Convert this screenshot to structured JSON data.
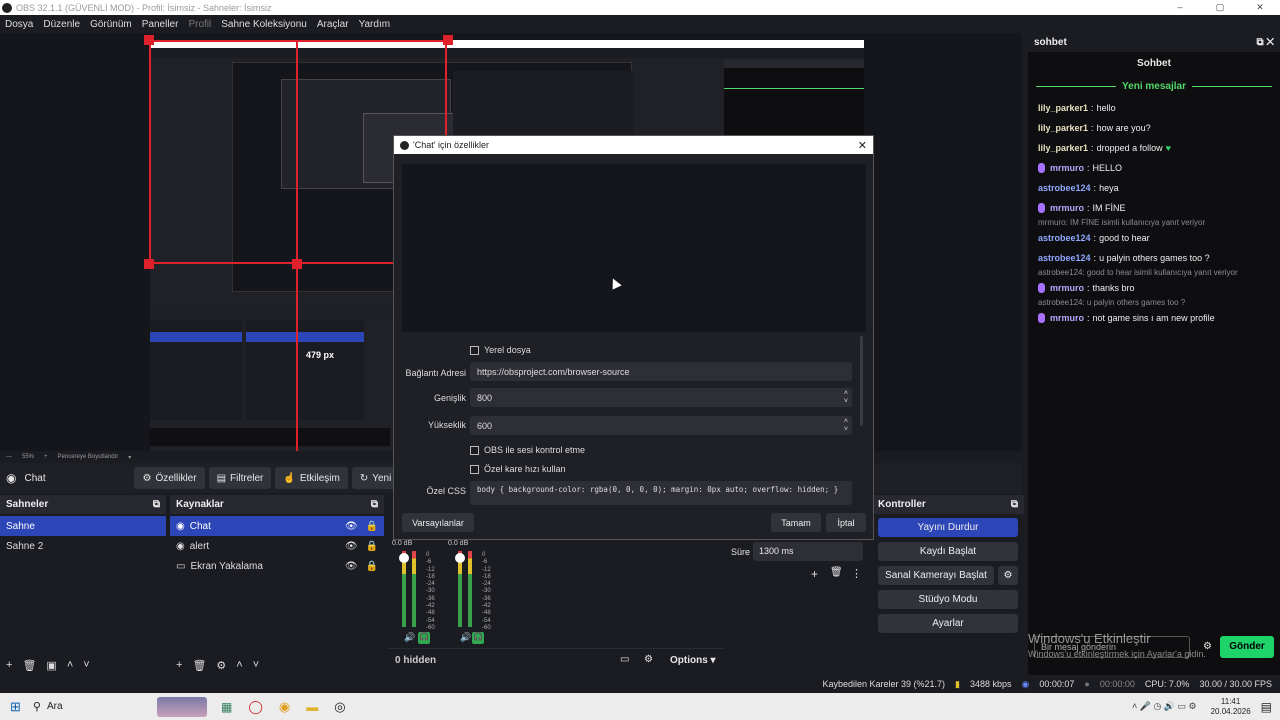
{
  "window": {
    "title": "OBS 32.1.1 (GÜVENLİ MOD) - Profil: İsimsiz - Sahneler: İsimsiz",
    "controls": [
      "–",
      "▢",
      "✕"
    ]
  },
  "menu": [
    "Dosya",
    "Düzenle",
    "Görünüm",
    "Paneller",
    "Profil",
    "Sahne Koleksiyonu",
    "Araçlar",
    "Yardım"
  ],
  "preview_zoom": {
    "zoom": "55%",
    "fit_label": "Pencereye Boyutlandır"
  },
  "source_toolbar": {
    "selected_source": "Chat",
    "properties": "Özellikler",
    "filters": "Filtreler",
    "interact": "Etkileşim",
    "refresh": "Yeni"
  },
  "scenes": {
    "title": "Sahneler",
    "items": [
      "Sahne",
      "Sahne 2"
    ],
    "selected_index": 0
  },
  "sources": {
    "title": "Kaynaklar",
    "items": [
      "Chat",
      "alert",
      "Ekran Yakalama"
    ],
    "selected_index": 0
  },
  "mixer": {
    "db_labels": [
      "0.0 dB",
      "0.0 dB"
    ],
    "scale": [
      "0",
      "-6",
      "-12",
      "-18",
      "-24",
      "-30",
      "-36",
      "-42",
      "-48",
      "-54",
      "-60"
    ],
    "hidden_label": "0 hidden",
    "options_label": "Options"
  },
  "transitions": {
    "duration_label": "Süre",
    "duration_value": "1300 ms"
  },
  "controls": {
    "title": "Kontroller",
    "stop_stream": "Yayını Durdur",
    "start_record": "Kaydı Başlat",
    "virtual_cam": "Sanal Kamerayı Başlat",
    "studio_mode": "Stüdyo Modu",
    "settings": "Ayarlar"
  },
  "dialog": {
    "title": "'Chat' için özellikler",
    "local_file": "Yerel dosya",
    "url_label": "Bağlantı Adresi",
    "url_value": "https://obsproject.com/browser-source",
    "width_label": "Genişlik",
    "width_value": "800",
    "height_label": "Yükseklik",
    "height_value": "600",
    "audio_control": "OBS ile sesi kontrol etme",
    "custom_fps": "Özel kare hızı kullan",
    "css_label": "Özel CSS",
    "css_value": "body { background-color: rgba(0, 0, 0, 0); margin: 0px auto; overflow: hidden; }",
    "defaults_btn": "Varsayılanlar",
    "ok_btn": "Tamam",
    "cancel_btn": "İptal"
  },
  "chat": {
    "dock_title": "sohbet",
    "header": "Sohbet",
    "new_messages": "Yeni mesajlar",
    "messages": [
      {
        "user": "lily_parker1",
        "text": "hello",
        "color": "#e8e0c0",
        "badge": false
      },
      {
        "user": "lily_parker1",
        "text": "how are you?",
        "color": "#e8e0c0",
        "badge": false
      },
      {
        "user": "lily_parker1",
        "text": "dropped a follow",
        "color": "#e8e0c0",
        "badge": false,
        "heart": "♥"
      },
      {
        "user": "mrmuro",
        "text": "HELLO",
        "color": "#b8a6ff",
        "badge": true
      },
      {
        "user": "astrobee124",
        "text": "heya",
        "color": "#8fa8ff",
        "badge": false
      },
      {
        "user": "mrmuro",
        "text": "IM FİNE",
        "color": "#b8a6ff",
        "badge": true
      },
      {
        "reply": "mrmuro: IM FİNE isimli kullanıcıya yanıt veriyor",
        "user": "astrobee124",
        "text": "good to hear",
        "color": "#8fa8ff",
        "badge": false
      },
      {
        "user": "astrobee124",
        "text": "u palyin others games too ?",
        "color": "#8fa8ff",
        "badge": false
      },
      {
        "reply": "astrobee124: good to hear isimli kullanıcıya yanıt veriyor",
        "user": "mrmuro",
        "text": "thanks bro",
        "color": "#b8a6ff",
        "badge": true
      },
      {
        "reply": "astrobee124: u palyin others games too ?",
        "user": "mrmuro",
        "text": "not game sins ı am new profile",
        "color": "#b8a6ff",
        "badge": true
      }
    ],
    "input_placeholder": "Bir mesaj gönderin",
    "send": "Gönder",
    "watermark_title": "Windows'u Etkinleştir",
    "watermark_sub": "Windows'u etkinleştirmek için Ayarlar'a gidin."
  },
  "status": {
    "dropped": "Kaybedilen Kareler 39 (%21.7)",
    "bitrate": "3488 kbps",
    "stream_time": "00:00:07",
    "rec_time": "00:00:00",
    "cpu": "CPU: 7.0%",
    "fps": "30.00 / 30.00 FPS"
  },
  "taskbar": {
    "search": "Ara",
    "time": "11:41",
    "date": "20.04.2026"
  },
  "nested": {
    "res_label": "479 px"
  }
}
